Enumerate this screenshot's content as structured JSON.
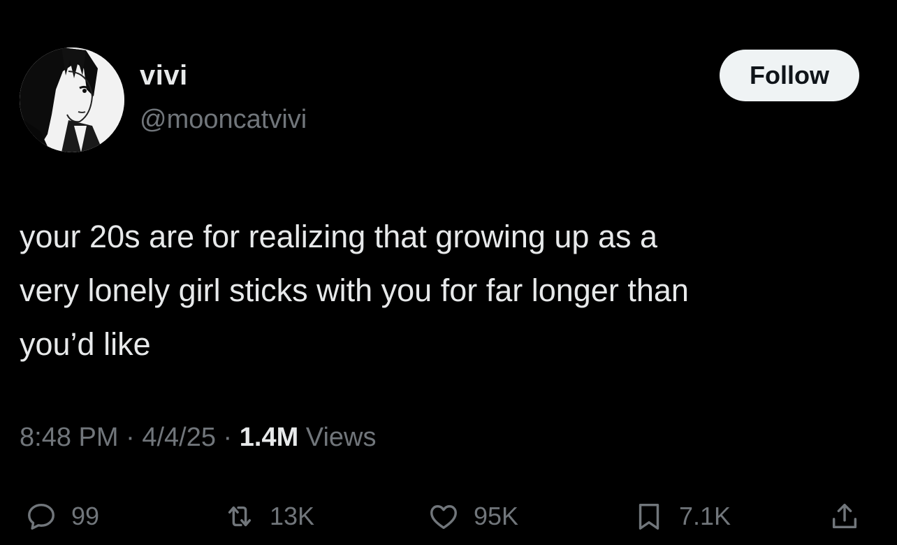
{
  "user": {
    "display_name": "vivi",
    "handle": "@mooncatvivi",
    "avatar_icon": "manga-girl-avatar"
  },
  "follow_button": {
    "label": "Follow"
  },
  "tweet": {
    "text": "your 20s are for realizing that growing up as a\nvery lonely girl sticks with you for far longer than\nyou’d like",
    "time": "8:48 PM",
    "date": "4/4/25",
    "separator": "·",
    "views_count": "1.4M",
    "views_label": "Views"
  },
  "actions": {
    "reply": {
      "icon": "reply-icon",
      "count": "99"
    },
    "retweet": {
      "icon": "retweet-icon",
      "count": "13K"
    },
    "like": {
      "icon": "heart-icon",
      "count": "95K"
    },
    "bookmark": {
      "icon": "bookmark-icon",
      "count": "7.1K"
    },
    "share": {
      "icon": "share-icon"
    }
  },
  "colors": {
    "background": "#000000",
    "primary_text": "#e7e9ea",
    "secondary_text": "#71767b",
    "follow_bg": "#eff3f4",
    "follow_text": "#0f1419"
  }
}
